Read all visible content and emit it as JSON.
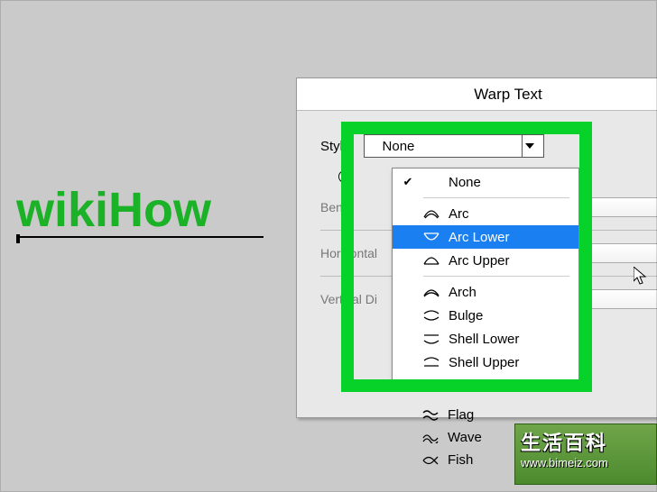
{
  "canvas": {
    "text": "wikiHow"
  },
  "dialog": {
    "title": "Warp Text",
    "style_label": "Style:",
    "combo_value": "None",
    "sliders": {
      "bend": {
        "label": "Bend:",
        "pct": "%"
      },
      "hdist": {
        "label": "Horizontal",
        "pct": "%"
      },
      "vdist": {
        "label": "Vertical Di",
        "pct": "%"
      }
    }
  },
  "dropdown": {
    "items": [
      {
        "label": "None",
        "checked": true,
        "icon": "none"
      },
      {
        "label": "Arc",
        "icon": "arc"
      },
      {
        "label": "Arc Lower",
        "icon": "arc-lower",
        "selected": true
      },
      {
        "label": "Arc Upper",
        "icon": "arc-upper"
      },
      {
        "label": "Arch",
        "icon": "arch"
      },
      {
        "label": "Bulge",
        "icon": "bulge"
      },
      {
        "label": "Shell Lower",
        "icon": "shell-lower"
      },
      {
        "label": "Shell Upper",
        "icon": "shell-upper"
      }
    ],
    "overflow": [
      {
        "label": "Flag",
        "icon": "flag"
      },
      {
        "label": "Wave",
        "icon": "wave"
      },
      {
        "label": "Fish",
        "icon": "fish"
      }
    ]
  },
  "watermark": {
    "big": "生活百科",
    "small": "www.bimeiz.com"
  }
}
